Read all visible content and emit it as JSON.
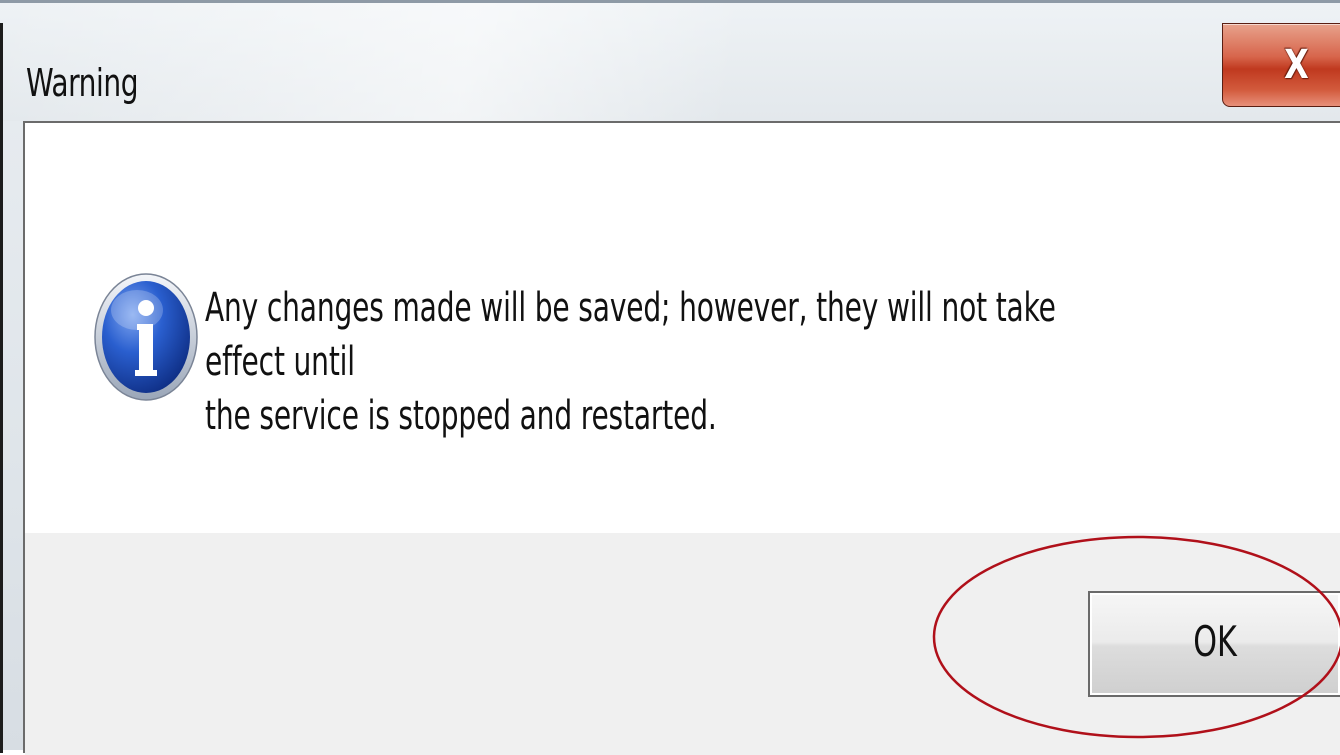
{
  "window": {
    "title": "Warning"
  },
  "titlebar": {
    "close_glyph": "X"
  },
  "dialog": {
    "icon": "information-icon",
    "message_line1": "Any changes made will be saved; however, they will not take effect until",
    "message_line2": "the service is stopped and restarted."
  },
  "buttons": {
    "ok_label": "OK"
  },
  "colors": {
    "close_button": "#c0391f",
    "info_icon_blue": "#1f4fb8",
    "highlight_circle": "#b0101a",
    "button_area_bg": "#f0f0f0"
  }
}
